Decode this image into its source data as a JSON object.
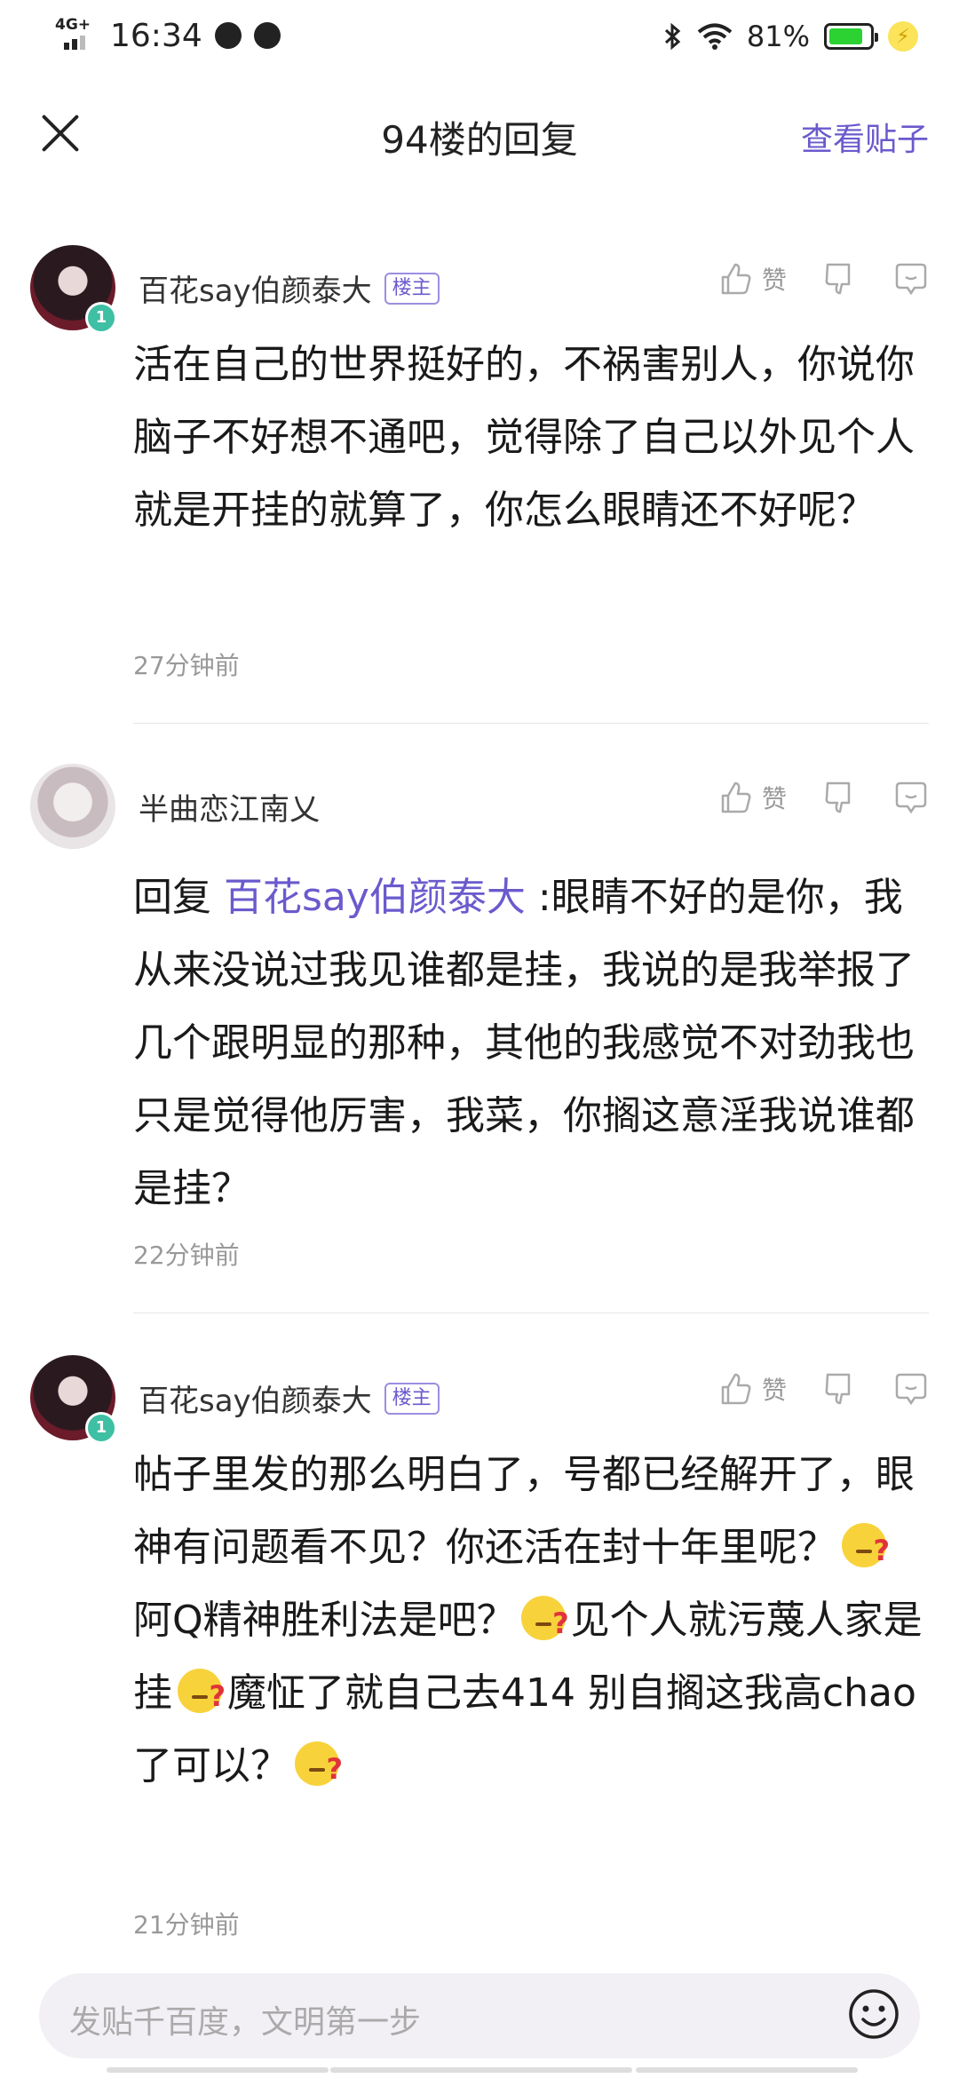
{
  "status_bar": {
    "network": "4G+",
    "time": "16:34",
    "battery": "81%"
  },
  "header": {
    "title": "94楼的回复",
    "view_post": "查看贴子"
  },
  "comments": [
    {
      "username": "百花say伯颜泰大",
      "badge": "楼主",
      "level": "1",
      "like_label": "赞",
      "text": "活在自己的世界挺好的，不祸害别人，你说你脑子不好想不通吧，觉得除了自己以外见个人就是开挂的就算了，你怎么眼睛还不好呢？",
      "time": "27分钟前"
    },
    {
      "username": "半曲恋江南乂",
      "like_label": "赞",
      "reply_prefix": "回复 ",
      "mention": "百花say伯颜泰大",
      "text": " :眼睛不好的是你，我从来没说过我见谁都是挂，我说的是我举报了几个跟明显的那种，其他的我感觉不对劲我也只是觉得他厉害，我菜，你搁这意淫我说谁都是挂？",
      "time": "22分钟前"
    },
    {
      "username": "百花say伯颜泰大",
      "badge": "楼主",
      "level": "1",
      "like_label": "赞",
      "text_parts": [
        "帖子里发的那么明白了，号都已经解开了，眼神有问题看不见？你还活在封十年里呢？",
        "阿Q精神胜利法是吧？",
        "见个人就污蔑人家是挂",
        "魔怔了就自己去414 别自搁这我高chao了可以？"
      ],
      "time": "21分钟前"
    }
  ],
  "input": {
    "placeholder": "发贴千百度，文明第一步"
  }
}
